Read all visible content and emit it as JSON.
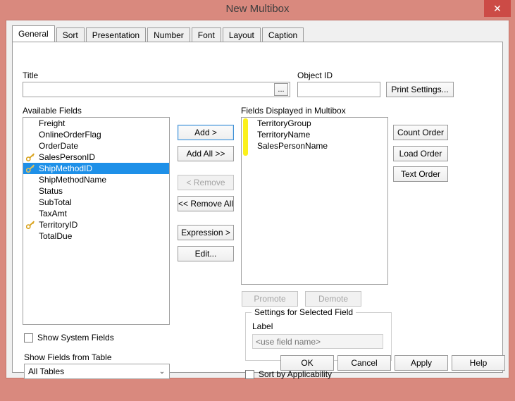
{
  "window": {
    "title": "New Multibox",
    "close_label": "✕",
    "titlebar_color": "#d9897e",
    "close_button_color": "#cc4b46"
  },
  "tabs": [
    {
      "label": "General",
      "active": true
    },
    {
      "label": "Sort",
      "active": false
    },
    {
      "label": "Presentation",
      "active": false
    },
    {
      "label": "Number",
      "active": false
    },
    {
      "label": "Font",
      "active": false
    },
    {
      "label": "Layout",
      "active": false
    },
    {
      "label": "Caption",
      "active": false
    }
  ],
  "top": {
    "title_label": "Title",
    "title_value": "",
    "title_browse_label": "...",
    "object_id_label": "Object ID",
    "object_id_value": "",
    "print_settings_label": "Print Settings..."
  },
  "available_fields": {
    "label": "Available Fields",
    "items": [
      {
        "name": "Freight",
        "key": false,
        "selected": false
      },
      {
        "name": "OnlineOrderFlag",
        "key": false,
        "selected": false
      },
      {
        "name": "OrderDate",
        "key": false,
        "selected": false
      },
      {
        "name": "SalesPersonID",
        "key": true,
        "selected": false
      },
      {
        "name": "ShipMethodID",
        "key": true,
        "selected": true
      },
      {
        "name": "ShipMethodName",
        "key": false,
        "selected": false
      },
      {
        "name": "Status",
        "key": false,
        "selected": false
      },
      {
        "name": "SubTotal",
        "key": false,
        "selected": false
      },
      {
        "name": "TaxAmt",
        "key": false,
        "selected": false
      },
      {
        "name": "TerritoryID",
        "key": true,
        "selected": false
      },
      {
        "name": "TotalDue",
        "key": false,
        "selected": false
      }
    ]
  },
  "transfer_buttons": [
    {
      "label": "Add >",
      "state": "default"
    },
    {
      "label": "Add All >>",
      "state": "enabled"
    },
    {
      "label": "< Remove",
      "state": "disabled"
    },
    {
      "label": "<< Remove All",
      "state": "enabled"
    },
    {
      "label": "Expression >",
      "state": "enabled"
    },
    {
      "label": "Edit...",
      "state": "enabled"
    }
  ],
  "displayed_fields": {
    "label": "Fields Displayed in Multibox",
    "items": [
      {
        "name": "TerritoryGroup"
      },
      {
        "name": "TerritoryName"
      },
      {
        "name": "SalesPersonName"
      }
    ],
    "highlight_color": "#fbf008"
  },
  "order_buttons": [
    {
      "label": "Count Order"
    },
    {
      "label": "Load Order"
    },
    {
      "label": "Text Order"
    }
  ],
  "move_buttons": [
    {
      "label": "Promote",
      "state": "disabled"
    },
    {
      "label": "Demote",
      "state": "disabled"
    }
  ],
  "settings_group": {
    "title": "Settings for Selected Field",
    "label_caption": "Label",
    "label_value": "",
    "label_placeholder": "<use field name>"
  },
  "sort_by_applicability": {
    "label": "Sort by Applicability",
    "checked": false
  },
  "show_system_fields": {
    "label": "Show System Fields",
    "checked": false
  },
  "show_fields_from_table": {
    "label": "Show Fields from Table",
    "value": "All Tables",
    "arrow": "⌄"
  },
  "footer_buttons": [
    {
      "label": "OK"
    },
    {
      "label": "Cancel"
    },
    {
      "label": "Apply"
    },
    {
      "label": "Help"
    }
  ]
}
